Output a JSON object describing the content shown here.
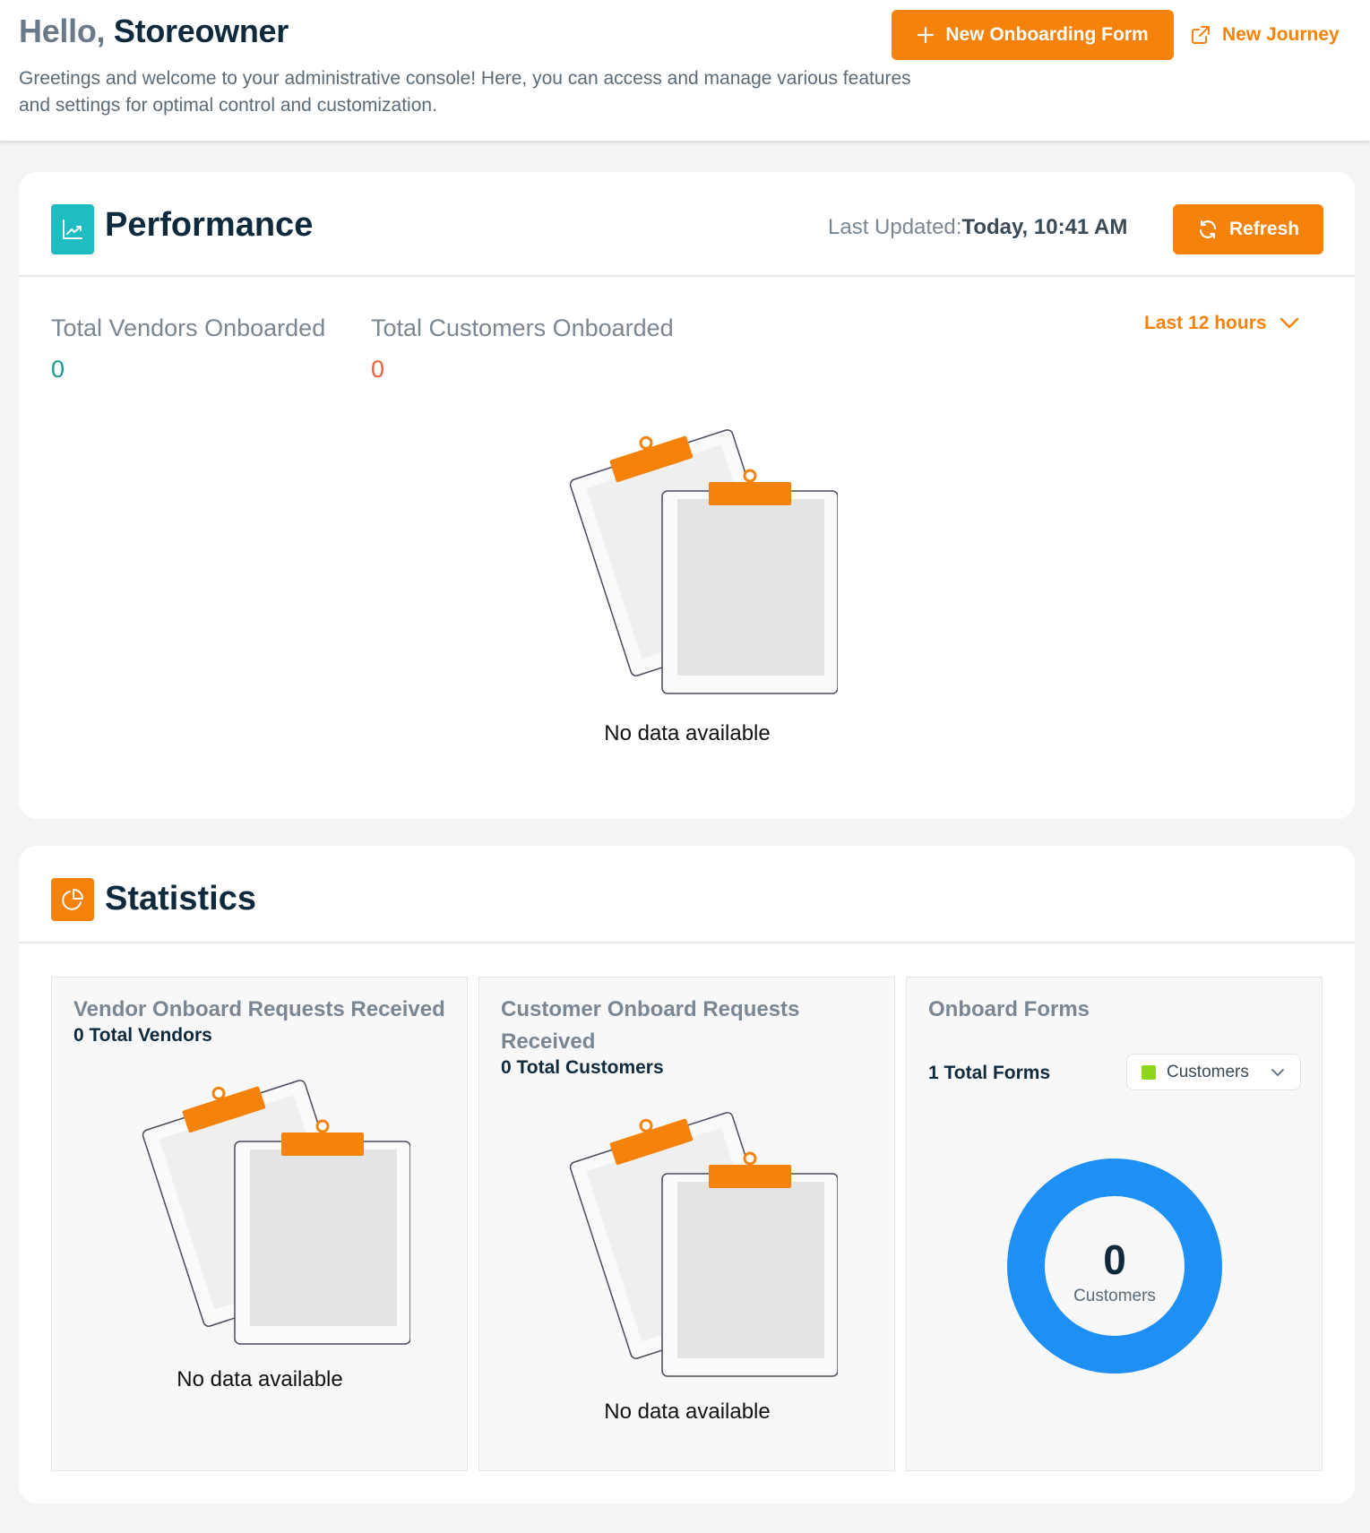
{
  "header": {
    "hello": "Hello,",
    "name": "Storeowner",
    "subtitle": "Greetings and welcome to your administrative console! Here, you can access and manage various features and settings for optimal control and customization.",
    "new_form_label": "New Onboarding Form",
    "new_journey_label": "New Journey"
  },
  "performance": {
    "title": "Performance",
    "last_updated_label": "Last Updated:",
    "last_updated_value": "Today, 10:41 AM",
    "refresh_label": "Refresh",
    "vendors_label": "Total Vendors Onboarded",
    "vendors_value": "0",
    "customers_label": "Total Customers Onboarded",
    "customers_value": "0",
    "range": "Last 12 hours",
    "empty_text": "No data available",
    "colors": {
      "vendors": "#1a9c8c",
      "customers": "#e8603c",
      "icon_bg": "#1fbcc1"
    }
  },
  "statistics": {
    "title": "Statistics",
    "icon_bg": "#f5820a",
    "vendor_panel": {
      "title": "Vendor Onboard Requests Received",
      "sub": "0 Total Vendors",
      "empty_text": "No data available"
    },
    "customer_panel": {
      "title": "Customer Onboard Requests Received",
      "sub": "0 Total Customers",
      "empty_text": "No data available"
    },
    "forms_panel": {
      "title": "Onboard Forms",
      "sub": "1 Total Forms",
      "filter": "Customers",
      "donut_value": "0",
      "donut_label": "Customers",
      "donut_color": "#1e90f5"
    }
  }
}
